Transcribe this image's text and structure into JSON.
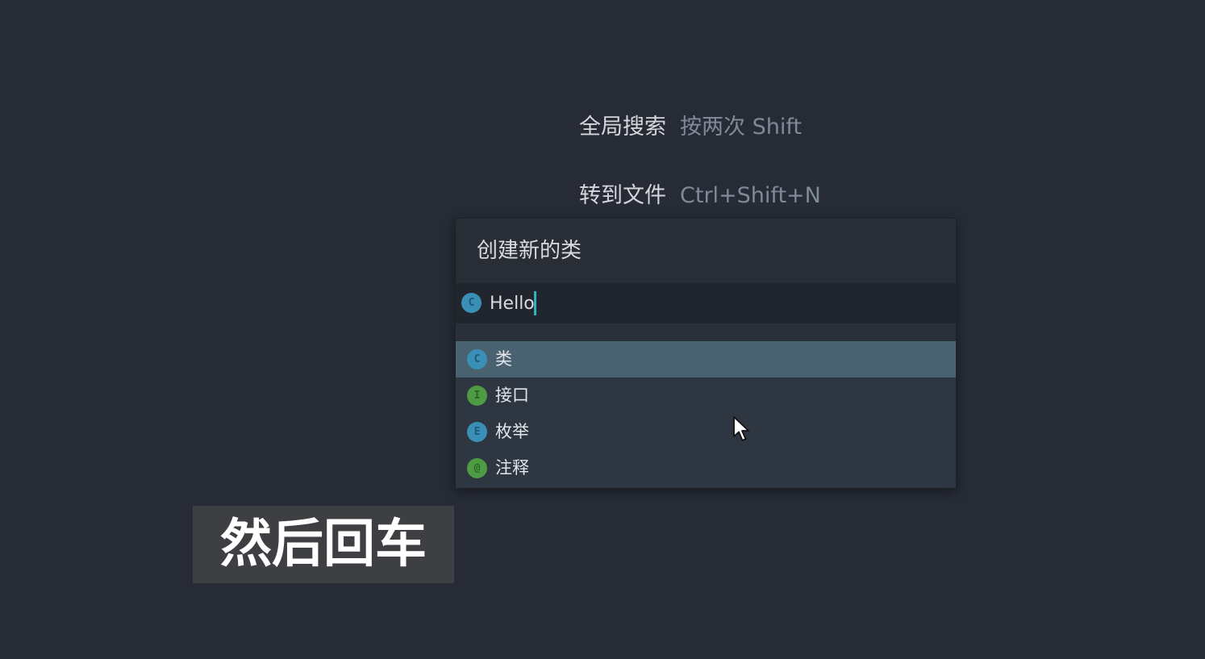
{
  "hints": {
    "search": {
      "label": "全局搜索",
      "shortcut": "按两次 Shift"
    },
    "goto_file": {
      "label": "转到文件",
      "shortcut": "Ctrl+Shift+N"
    }
  },
  "dialog": {
    "title": "创建新的类",
    "input": {
      "kind_letter": "C",
      "value": "Hello"
    },
    "items": [
      {
        "letter": "C",
        "label": "类",
        "selected": true
      },
      {
        "letter": "I",
        "label": "接口",
        "selected": false
      },
      {
        "letter": "E",
        "label": "枚举",
        "selected": false
      },
      {
        "letter": "@",
        "label": "注释",
        "selected": false
      }
    ]
  },
  "subtitle": "然后回车",
  "colors": {
    "background": "#262b35",
    "popup": "#2e3641",
    "selected_row": "#4a6170",
    "caret": "#2fb3c0",
    "class_icon": "#3a8fb7",
    "interface_icon": "#4f9a45",
    "annotation_icon": "#4f9a45"
  },
  "icons": {
    "class": "class-icon",
    "interface": "interface-icon",
    "enum": "enum-icon",
    "annotation": "annotation-icon",
    "pointer": "mouse-pointer-icon"
  }
}
